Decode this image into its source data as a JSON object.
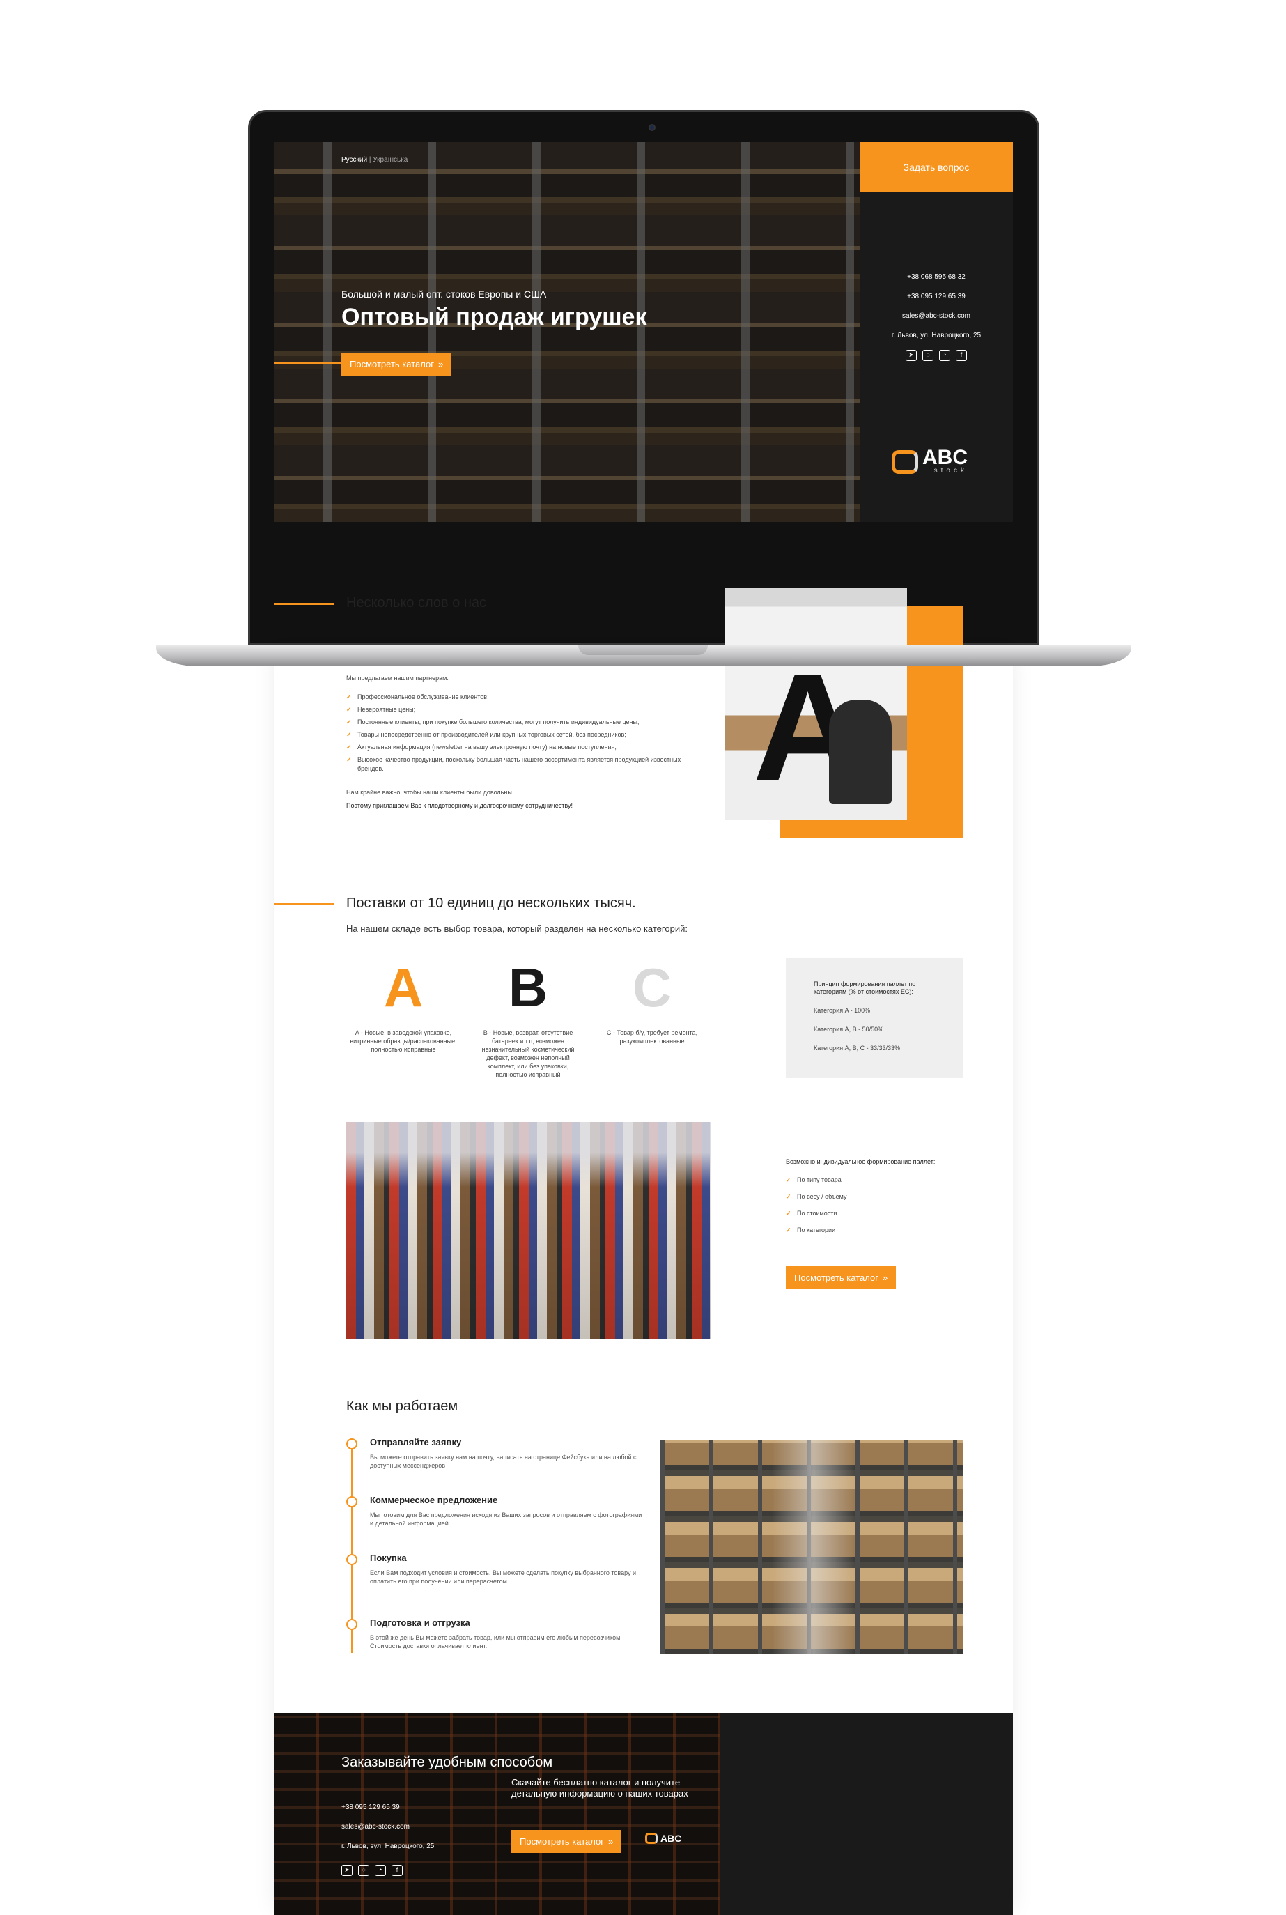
{
  "hero": {
    "lang_ru": "Русский",
    "lang_sep": "|",
    "lang_ua": "Українська",
    "subtitle": "Большой и малый опт. стоков Европы и США",
    "title": "Оптовый продаж игрушек",
    "catalog_button": "Посмотреть каталог",
    "ask_button": "Задать вопрос",
    "phone1": "+38 068 595 68 32",
    "phone2": "+38 095 129 65 39",
    "email": "sales@abc-stock.com",
    "address": "г. Львов, ул. Навроцкого, 25",
    "logo_main": "ABC",
    "logo_sub": "stock"
  },
  "about": {
    "title": "Несколько слов о нас",
    "intro": "Мы предлагаем нашим партнерам:",
    "items": [
      "Профессиональное обслуживание клиентов;",
      "Невероятные цены;",
      "Постоянные клиенты, при покупке большего количества, могут получить индивидуальные цены;",
      "Товары непосредственно от производителей или крупных торговых сетей, без посредников;",
      "Актуальная информация (newsletter на вашу электронную почту) на новые поступления;",
      "Высокое качество продукции, поскольку большая часть нашего ассортимента является продукцией известных брендов."
    ],
    "line1": "Нам крайне важно, чтобы наши клиенты были довольны.",
    "line2": "Поэтому приглашаем Вас к плодотворному и долгосрочному сотрудничеству!",
    "photo_letter": "A"
  },
  "supply": {
    "title": "Поставки от 10 единиц до нескольких тысяч.",
    "subtitle": "На нашем складе есть выбор товара, который разделен на несколько категорий:",
    "categories": [
      {
        "letter": "A",
        "color": "#f7941d",
        "desc": "A - Новые, в заводской упаковке, витринные образцы/распакованные, полностью исправные"
      },
      {
        "letter": "B",
        "color": "#1a1a1a",
        "desc": "B - Новые, возврат, отсутствие батареек и т.п, возможен незначительный косметический дефект, возможен неполный комплект, или без упаковки, полностью исправный"
      },
      {
        "letter": "C",
        "color": "#d9d9d9",
        "desc": "C - Товар б/у, требует ремонта, разукомплектованные"
      }
    ],
    "box_title": "Принцип формирования паллет по категориям (% от стоимостях ЕС):",
    "box_items": [
      "Категория A - 100%",
      "Категория A, B - 50/50%",
      "Категория A, B, C - 33/33/33%"
    ],
    "options_title": "Возможно индивидуальное формирование паллет:",
    "options": [
      "По типу товара",
      "По весу / объему",
      "По стоимости",
      "По категории"
    ],
    "catalog_button": "Посмотреть каталог"
  },
  "how": {
    "title": "Как мы работаем",
    "steps": [
      {
        "title": "Отправляйте заявку",
        "desc": "Вы можете отправить заявку нам на почту, написать на странице Фейсбука или на любой с доступных мессенджеров"
      },
      {
        "title": "Коммерческое предложение",
        "desc": "Мы готовим для Вас предложения исходя из Ваших запросов и отправляем с фотографиями и детальной информацией"
      },
      {
        "title": "Покупка",
        "desc": "Если Вам подходит условия и стоимость, Вы можете сделать покупку выбранного товару и оплатить его при получении или перерасчетом"
      },
      {
        "title": "Подготовка и отгрузка",
        "desc": "В этой же день Вы можете забрать товар, или мы отправим его любым перевозчиком. Стоимость доставки оплачивает клиент."
      }
    ]
  },
  "footer": {
    "title": "Заказывайте удобным способом",
    "phone": "+38 095 129 65 39",
    "email": "sales@abc-stock.com",
    "address": "г. Львов, вул. Навроцкого, 25",
    "cta_text": "Скачайте бесплатно каталог и получите детальную информацию о наших товарах",
    "catalog_button": "Посмотреть каталог",
    "logo_main": "ABC"
  },
  "icons": [
    "telegram-icon",
    "whatsapp-icon",
    "viber-icon",
    "facebook-icon"
  ],
  "colors": {
    "accent": "#f7941d",
    "dark": "#1a1a1a"
  }
}
